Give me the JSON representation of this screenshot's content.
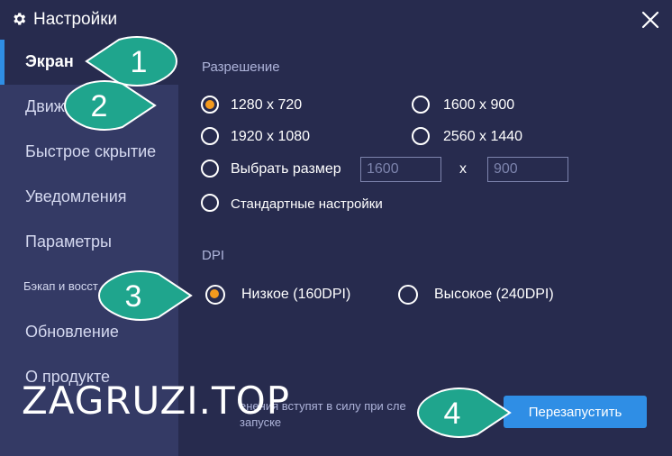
{
  "window": {
    "title": "Настройки",
    "close_icon": "close-icon",
    "settings_icon": "gear-icon"
  },
  "sidebar": {
    "items": [
      {
        "label": "Экран",
        "active": true
      },
      {
        "label": "Движ",
        "active": false
      },
      {
        "label": "Быстрое скрытие",
        "active": false
      },
      {
        "label": "Уведомления",
        "active": false
      },
      {
        "label": "Параметры",
        "active": false
      },
      {
        "label": "Бэкап и восст",
        "active": false
      },
      {
        "label": "Обновление",
        "active": false
      },
      {
        "label": "О продукте",
        "active": false
      }
    ]
  },
  "resolution": {
    "title": "Разрешение",
    "options": [
      {
        "label": "1280 x 720",
        "checked": true
      },
      {
        "label": "1600 x 900",
        "checked": false
      },
      {
        "label": "1920 x 1080",
        "checked": false
      },
      {
        "label": "2560 x 1440",
        "checked": false
      },
      {
        "label": "Выбрать размер",
        "checked": false
      },
      {
        "label": "Стандартные настройки",
        "checked": false
      }
    ],
    "custom_width_placeholder": "1600",
    "custom_height_placeholder": "900",
    "separator": "x"
  },
  "dpi": {
    "title": "DPI",
    "options": [
      {
        "label": "Низкое (160DPI)",
        "checked": true
      },
      {
        "label": "Высокое (240DPI)",
        "checked": false
      }
    ]
  },
  "footer": {
    "note_line1": "енения вступят в силу при сле",
    "note_line2": "запуске",
    "restart_label": "Перезапустить"
  },
  "markers": [
    "1",
    "2",
    "3",
    "4"
  ],
  "watermark": "ZAGRUZI.TOP",
  "colors": {
    "background": "#272b4e",
    "sidebar": "#343a65",
    "accent": "#2f8ee5",
    "radio_checked": "#f39a1e",
    "marker": "#1fa58d"
  }
}
